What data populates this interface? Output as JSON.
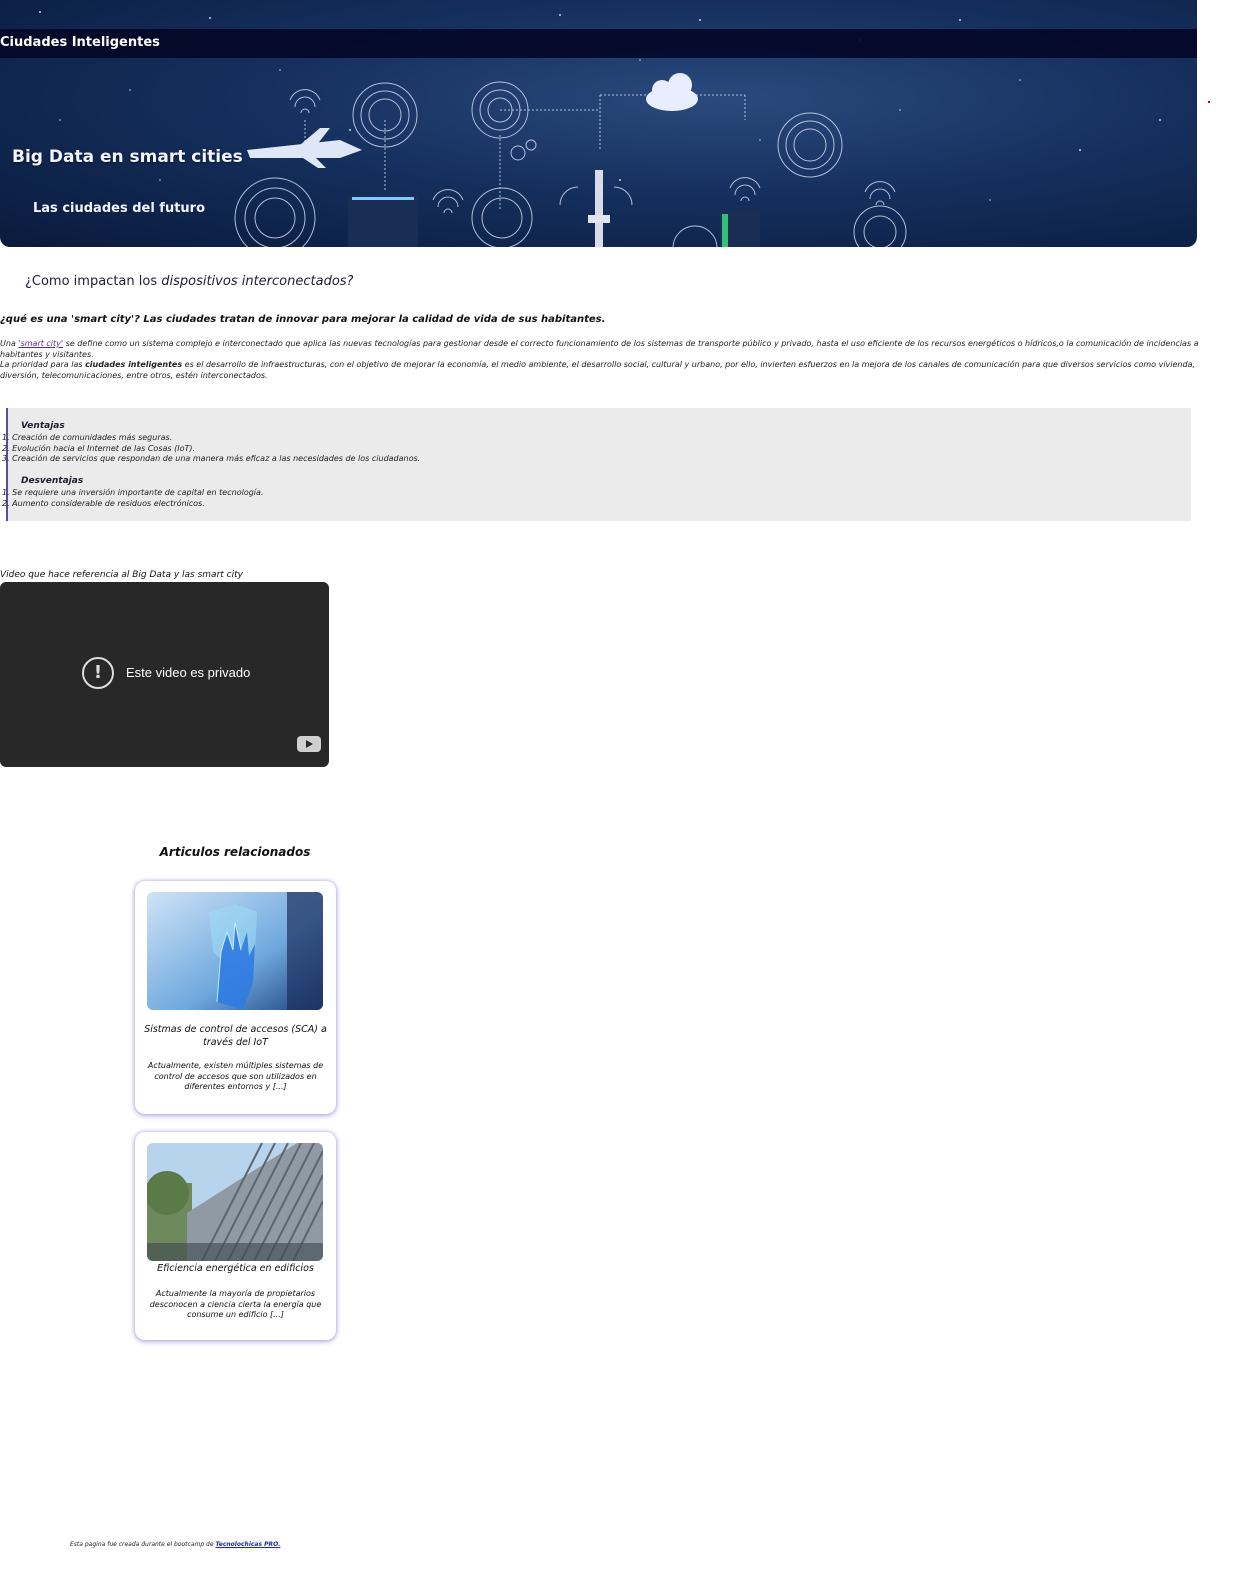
{
  "hero": {
    "bar_title": "Ciudades Inteligentes",
    "title": "Big Data en smart cities",
    "subtitle": "Las ciudades del futuro"
  },
  "article": {
    "question_prefix": "¿Como impactan los ",
    "question_emphasis": "dispositivos interconectados?",
    "intro_question": "¿qué es una 'smart city'? Las ciudades tratan de innovar para mejorar la calidad de vida de sus habitantes.",
    "p1_prefix": "Una ",
    "p1_link": "'smart city'",
    "p1_text": " se define como un sistema complejo e interconectado que aplica las nuevas tecnologías para gestionar desde el correcto funcionamiento de los sistemas de transporte público y privado, hasta el uso eficiente de los recursos energéticos o hídricos,o la comunicación de incidencias a habitantes y visitantes.",
    "p2_prefix": "La prioridad para las ",
    "p2_bold": "ciudades inteligentes",
    "p2_text": " es el desarrollo de infraestructuras, con el objetivo de mejorar la economía, el medio ambiente, el desarrollo social, cultural y urbano, por ello, invierten esfuerzos en la mejora de los canales de comunicación para que diversos servicios como vivienda, diversión, telecomunicaciones, entre otros, estén interconectados."
  },
  "pros_cons": {
    "advantages_title": "Ventajas",
    "advantages": [
      "1. Creación de comunidades más seguras.",
      "2. Evolución hacia el Internet de las Cosas (IoT).",
      "3. Creación de servicios que respondan de una manera más eficaz a las necesidades de los ciudadanos."
    ],
    "disadvantages_title": "Desventajas",
    "disadvantages": [
      "1. Se requiere una inversión importante de capital en tecnología.",
      "2. Aumento considerable de residuos electrónicos."
    ]
  },
  "video": {
    "caption": "Video que hace referencia al Big Data y las smart city",
    "message": "Este video es privado",
    "alert_icon": "!"
  },
  "related": {
    "title": "Articulos relacionados",
    "cards": [
      {
        "title": "Sistmas de control de accesos (SCA) a través del IoT",
        "excerpt": "Actualmente, existen múltiples sistemas de control de accesos que son utilizados en diferentes entornos y [...]"
      },
      {
        "title": "Eficiencia energética en edificios",
        "excerpt": "Actualmente la mayoría de propietarios desconocen a ciencia cierta la energía que consume un edificio [...]"
      }
    ]
  },
  "footer": {
    "text": "Esta pagina fue creada durante el bootcamp de ",
    "link": "Tecnolochicas PRO."
  },
  "colors": {
    "hero_bar": "#04082a",
    "accent_border": "#5b4aa6",
    "quote_bg": "#ebebeb",
    "video_bg": "#282828",
    "link": "#5a2a8a"
  }
}
